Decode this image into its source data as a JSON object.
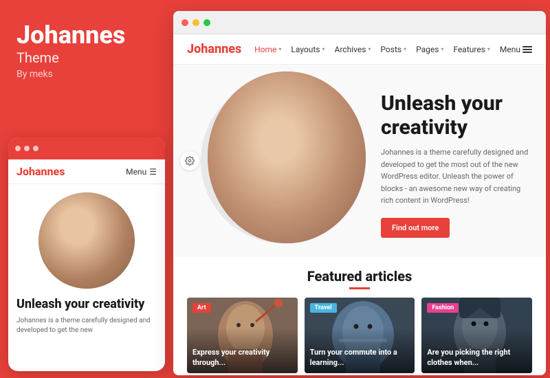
{
  "leftPanel": {
    "brandName": "Johannes",
    "brandSub": "Theme",
    "brandBy": "By meks"
  },
  "mobileMockup": {
    "dots": [
      "•",
      "•",
      "•"
    ],
    "logo": "Johannes",
    "menuLabel": "Menu",
    "heroHeading": "Unleash your creativity",
    "heroDesc": "Johannes is a theme carefully designed and developed to get the new"
  },
  "browser": {
    "nav": {
      "logo": "Johannes",
      "items": [
        {
          "label": "Home",
          "hasArrow": true,
          "active": true
        },
        {
          "label": "Layouts",
          "hasArrow": true
        },
        {
          "label": "Archives",
          "hasArrow": true
        },
        {
          "label": "Posts",
          "hasArrow": true
        },
        {
          "label": "Pages",
          "hasArrow": true
        },
        {
          "label": "Features",
          "hasArrow": true
        },
        {
          "label": "Menu"
        }
      ]
    },
    "hero": {
      "heading": "Unleash your creativity",
      "desc": "Johannes is a theme carefully designed and developed to get the most out of the new WordPress editor. Unleash the power of blocks - an awesome new way of creating rich content in WordPress!",
      "btnLabel": "Find out more"
    },
    "featured": {
      "title": "Featured articles",
      "articles": [
        {
          "badge": "Art",
          "badgeClass": "badge-art",
          "text": "Express your creativity through..."
        },
        {
          "badge": "Travel",
          "badgeClass": "badge-travel",
          "text": "Turn your commute into a learning..."
        },
        {
          "badge": "Fashion",
          "badgeClass": "badge-fashion",
          "text": "Are you picking the right clothes when..."
        }
      ]
    }
  }
}
